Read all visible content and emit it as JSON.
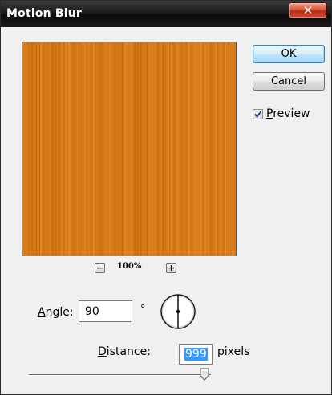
{
  "window": {
    "title": "Motion Blur",
    "close_icon": "close-icon"
  },
  "buttons": {
    "ok_label": "OK",
    "cancel_label": "Cancel"
  },
  "preview": {
    "checked": true,
    "label_mnemonic": "P",
    "label_rest": "review"
  },
  "zoom": {
    "out_glyph": "−",
    "in_glyph": "+",
    "level": "100%"
  },
  "angle": {
    "label_mnemonic": "A",
    "label_rest": "ngle:",
    "value": "90",
    "unit": "°",
    "dial_icon": "angle-dial-icon"
  },
  "distance": {
    "label_mnemonic": "D",
    "label_rest": "istance:",
    "value": "999",
    "unit": "pixels",
    "slider_fraction": 1.0
  },
  "colors": {
    "preview_base": "#d77a18",
    "preview_streak_dark": "#b35c0c",
    "preview_streak_light": "#e99535",
    "selection": "#3399ff"
  }
}
